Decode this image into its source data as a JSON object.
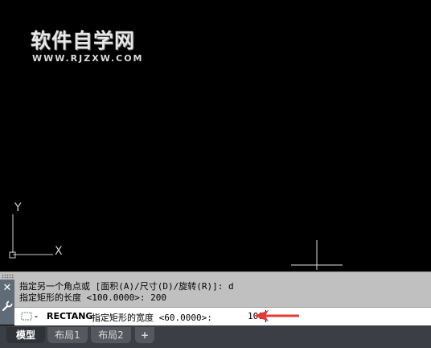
{
  "watermark": {
    "title_cn": "软件自学网",
    "url": "WWW.RJZXW.COM"
  },
  "ucs": {
    "y_label": "Y",
    "x_label": "X"
  },
  "command_history": [
    "指定另一个角点或 [面积(A)/尺寸(D)/旋转(R)]: d",
    "指定矩形的长度 <100.0000>: 200"
  ],
  "command_line": {
    "command": "RECTANG",
    "prompt": "指定矩形的宽度 <60.0000>:",
    "input_value": "100"
  },
  "side_buttons": {
    "close": "✕",
    "customize": "🔧"
  },
  "tabs": [
    {
      "label": "模型",
      "active": true
    },
    {
      "label": "布局1",
      "active": false
    },
    {
      "label": "布局2",
      "active": false
    },
    {
      "label": "+",
      "active": false
    }
  ],
  "colors": {
    "canvas": "#000000",
    "annotation_arrow": "#e53935"
  }
}
